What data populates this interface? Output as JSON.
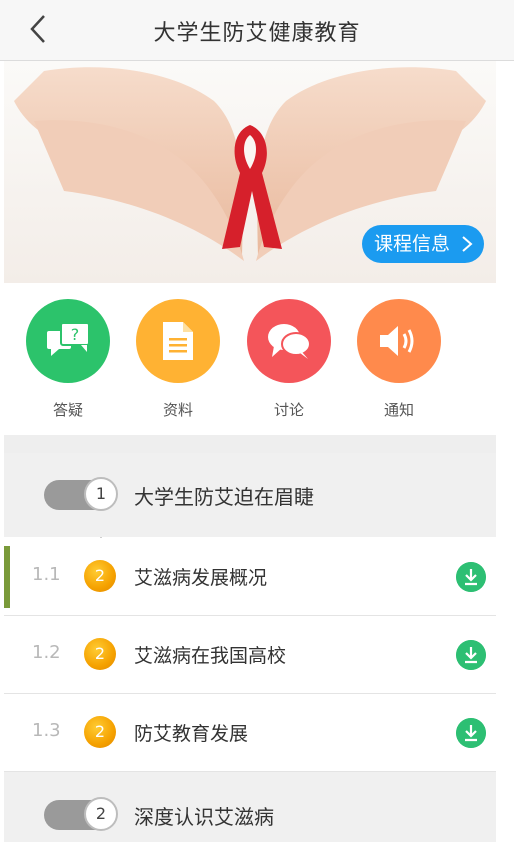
{
  "header": {
    "title": "大学生防艾健康教育",
    "back_icon": "chevron-left-icon"
  },
  "banner": {
    "button_label": "课程信息"
  },
  "actions": [
    {
      "label": "答疑",
      "icon": "qa-icon",
      "color": "#2cc36b"
    },
    {
      "label": "资料",
      "icon": "document-icon",
      "color": "#ffb233"
    },
    {
      "label": "讨论",
      "icon": "chat-icon",
      "color": "#f4555a"
    },
    {
      "label": "通知",
      "icon": "speaker-icon",
      "color": "#ff8a4c"
    }
  ],
  "chapters": [
    {
      "number": "1",
      "title": "大学生防艾迫在眉睫"
    },
    {
      "number": "2",
      "title": "深度认识艾滋病"
    }
  ],
  "lessons": [
    {
      "number": "1.1",
      "badge": "2",
      "title": "艾滋病发展概况"
    },
    {
      "number": "1.2",
      "badge": "2",
      "title": "艾滋病在我国高校"
    },
    {
      "number": "1.3",
      "badge": "2",
      "title": "防艾教育发展"
    }
  ],
  "colors": {
    "accent": "#1b9bf0",
    "download": "#2dbf73",
    "ribbon": "#d6202b"
  }
}
